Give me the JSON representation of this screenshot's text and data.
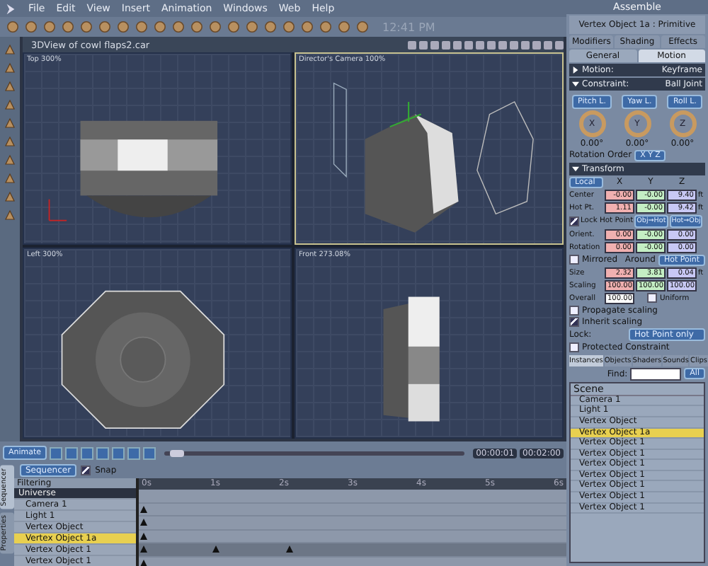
{
  "menu": [
    "File",
    "Edit",
    "View",
    "Insert",
    "Animation",
    "Windows",
    "Web",
    "Help"
  ],
  "clock": "12:41 PM",
  "room": "Assemble",
  "document": {
    "title": "3DView of cowl flaps2.car"
  },
  "viewports": [
    {
      "label": "Top 300%",
      "kind": "top",
      "selected": false
    },
    {
      "label": "Director's Camera 100%",
      "kind": "camera",
      "selected": true
    },
    {
      "label": "Left 300%",
      "kind": "left",
      "selected": false
    },
    {
      "label": "Front 273.08%",
      "kind": "front",
      "selected": false
    }
  ],
  "properties": {
    "title": "Vertex Object 1a : Primitive",
    "tabs": [
      {
        "label": "Modifiers",
        "selected": false
      },
      {
        "label": "Shading",
        "selected": false
      },
      {
        "label": "Effects",
        "selected": false
      }
    ],
    "subtabs": [
      {
        "label": "General",
        "selected": false
      },
      {
        "label": "Motion",
        "selected": true
      }
    ],
    "sections": [
      {
        "label": "Motion:",
        "value": "Keyframe",
        "expanded": false
      },
      {
        "label": "Constraint:",
        "value": "Ball Joint",
        "expanded": true
      }
    ],
    "limit_buttons": [
      "Pitch L.",
      "Yaw L.",
      "Roll L."
    ],
    "dials": [
      {
        "axis": "X",
        "reading": "0.00°"
      },
      {
        "axis": "Y",
        "reading": "0.00°"
      },
      {
        "axis": "Z",
        "reading": "0.00°"
      }
    ],
    "rotation_order": {
      "label": "Rotation Order",
      "value": "X Y Z"
    },
    "transform": {
      "header": "Transform",
      "expanded": true,
      "space": "Local",
      "axes": [
        "X",
        "Y",
        "Z"
      ],
      "rows": [
        {
          "label": "Center",
          "values": [
            "-0.00",
            "-0.00",
            "9.40"
          ],
          "unit": "ft"
        },
        {
          "label": "Hot Pt.",
          "values": [
            "1.11",
            "-0.00",
            "9.42"
          ],
          "unit": "ft"
        }
      ],
      "lock_hot_point": {
        "label": "Lock Hot Point",
        "checked": true
      },
      "hot_buttons": [
        "Obj→Hot",
        "Hot→Obj"
      ],
      "rotation_rows": [
        {
          "label": "Orient.",
          "values": [
            "0.00",
            "-0.00",
            "0.00"
          ]
        },
        {
          "label": "Rotation",
          "values": [
            "0.00",
            "-0.00",
            "0.00"
          ]
        }
      ],
      "mirrored": {
        "label": "Mirrored",
        "checked": false
      },
      "around": {
        "label": "Around",
        "value": "Hot Point"
      },
      "size_rows": [
        {
          "label": "Size",
          "values": [
            "2.32",
            "3.81",
            "0.04"
          ],
          "unit": "ft"
        },
        {
          "label": "Scaling",
          "values": [
            "100.00",
            "100.00",
            "100.00"
          ]
        }
      ],
      "overall": {
        "label": "Overall",
        "value": "100.00"
      },
      "uniform": {
        "label": "Uniform",
        "checked": false
      },
      "propagate": {
        "label": "Propagate scaling",
        "checked": false
      },
      "inherit": {
        "label": "Inherit scaling",
        "checked": true
      },
      "lock": {
        "label": "Lock:",
        "value": "Hot Point only"
      },
      "protected": {
        "label": "Protected Constraint",
        "checked": false
      }
    }
  },
  "browser": {
    "tabs": [
      {
        "label": "Instances",
        "selected": true
      },
      {
        "label": "Objects",
        "selected": false
      },
      {
        "label": "Shaders",
        "selected": false
      },
      {
        "label": "Sounds",
        "selected": false
      },
      {
        "label": "Clips",
        "selected": false
      }
    ],
    "find_label": "Find:",
    "filter": "All",
    "heading": "Scene",
    "items": [
      {
        "label": "Camera 1",
        "selected": false
      },
      {
        "label": "Light 1",
        "selected": false
      },
      {
        "label": "Vertex Object",
        "selected": false
      },
      {
        "label": "Vertex Object 1a",
        "selected": true
      },
      {
        "label": "Vertex Object 1",
        "selected": false
      },
      {
        "label": "Vertex Object 1",
        "selected": false
      },
      {
        "label": "Vertex Object 1",
        "selected": false
      },
      {
        "label": "Vertex Object 1",
        "selected": false
      },
      {
        "label": "Vertex Object 1",
        "selected": false
      },
      {
        "label": "Vertex Object 1",
        "selected": false
      },
      {
        "label": "Vertex Object 1",
        "selected": false
      }
    ]
  },
  "timeline": {
    "animate": "Animate",
    "scrub": {
      "level": 0.02
    },
    "current_time": "00:00:01",
    "end_time": "00:02:00",
    "mode": "Sequencer",
    "snap": {
      "label": "Snap",
      "checked": true
    },
    "filtering": "Filtering",
    "side_tabs": [
      {
        "label": "Sequencer",
        "selected": true
      },
      {
        "label": "Properties",
        "selected": false
      }
    ],
    "ticks": [
      "0s",
      "1s",
      "2s",
      "3s",
      "4s",
      "5s",
      "6s"
    ],
    "tracks": [
      {
        "label": "Universe",
        "kind": "group",
        "selected": false
      },
      {
        "label": "Camera 1",
        "kind": "item",
        "selected": false
      },
      {
        "label": "Light 1",
        "kind": "item",
        "selected": false
      },
      {
        "label": "Vertex Object",
        "kind": "item",
        "selected": false
      },
      {
        "label": "Vertex Object 1a",
        "kind": "item",
        "selected": true
      },
      {
        "label": "Vertex Object 1",
        "kind": "item",
        "selected": false
      },
      {
        "label": "Vertex Object 1",
        "kind": "item",
        "selected": false
      }
    ]
  }
}
